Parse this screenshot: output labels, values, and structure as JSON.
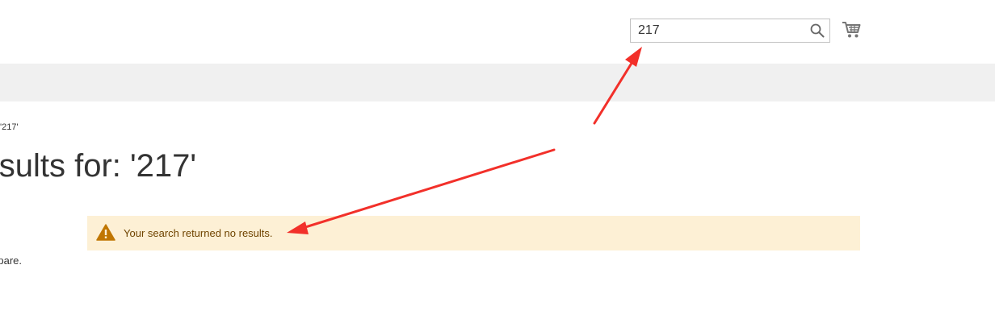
{
  "header": {
    "search": {
      "value": "217",
      "icon": "search-icon"
    },
    "cart": {
      "icon": "cart-icon"
    }
  },
  "breadcrumb": {
    "text": "'217'"
  },
  "main": {
    "title": "sults for: '217'",
    "notice": {
      "icon": "warning-icon",
      "message": "Your search returned no results."
    },
    "compare_text": "pare."
  },
  "annotations": {
    "arrow_color": "#f2302a"
  },
  "colors": {
    "nav_band": "#f0f0f0",
    "notice_background": "#fdf0d5",
    "notice_text": "#6f4400",
    "warning_icon": "#c07600"
  }
}
